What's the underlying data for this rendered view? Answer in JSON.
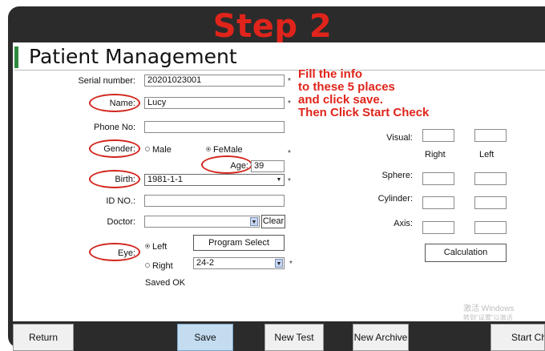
{
  "step_title": "Step 2",
  "page_title": "Patient Management",
  "annotation": [
    "Fill the info",
    "to these 5 places",
    "and click save.",
    "Then Click Start Check"
  ],
  "form": {
    "serial": {
      "label": "Serial number:",
      "value": "20201023001"
    },
    "name": {
      "label": "Name:",
      "value": "Lucy"
    },
    "phone": {
      "label": "Phone No:",
      "value": ""
    },
    "gender": {
      "label": "Gender:",
      "options": [
        "Male",
        "FeMale"
      ],
      "selected": "FeMale"
    },
    "age": {
      "label": "Age:",
      "value": "39"
    },
    "birth": {
      "label": "Birth:",
      "value": "1981-1-1"
    },
    "id_no": {
      "label": "ID NO.:",
      "value": ""
    },
    "doctor": {
      "label": "Doctor:",
      "value": "",
      "clear_label": "Clear"
    },
    "eye": {
      "label": "Eye:",
      "options": [
        "Left",
        "Right"
      ],
      "selected": "Left"
    },
    "program_select_label": "Program Select",
    "program_value": "24-2",
    "status": "Saved OK",
    "required_mark": "*"
  },
  "vision": {
    "visual_label": "Visual:",
    "right_label": "Right",
    "left_label": "Left",
    "sphere_label": "Sphere:",
    "cylinder_label": "Cylinder:",
    "axis_label": "Axis:",
    "calculation_label": "Calculation"
  },
  "watermark": [
    "激活 Windows",
    "转到\"设置\"以激活 Windows。"
  ],
  "bottom_buttons": {
    "return": "Return",
    "save": "Save",
    "new_test": "New Test",
    "new_archive": "New Archive",
    "start_check": "Start Check"
  },
  "colors": {
    "annotation_red": "#e0241b",
    "header_accent": "#2e8b3e",
    "frame": "#2b2b2b",
    "save_button": "#c4dcf0"
  }
}
